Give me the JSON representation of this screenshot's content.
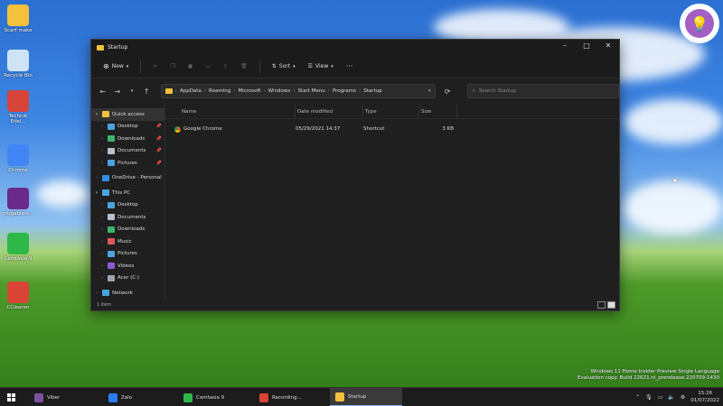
{
  "desktop": {
    "icons": [
      {
        "label": "Scarf make",
        "icon": "folder-icon",
        "color": "#f3c13a"
      },
      {
        "label": "Recycle Bin",
        "icon": "recycle-bin-icon",
        "color": "#cfe3f7"
      },
      {
        "label": "Technik Eifel...",
        "icon": "app-icon",
        "color": "#d8433a"
      },
      {
        "label": "Chrome",
        "icon": "chrome-icon",
        "color": "#4285f4"
      },
      {
        "label": "plugable-s...",
        "icon": "app-icon",
        "color": "#6a2a8a"
      },
      {
        "label": "Camtasia 9",
        "icon": "camtasia-icon",
        "color": "#2fb84a"
      },
      {
        "label": "CCleaner",
        "icon": "ccleaner-icon",
        "color": "#d94434"
      }
    ]
  },
  "window": {
    "title": "Startup",
    "controls": {
      "minimize": "–",
      "maximize": "□",
      "close": "✕"
    },
    "toolbar": {
      "new_label": "New",
      "sort_label": "Sort",
      "view_label": "View",
      "more_label": "···"
    },
    "address": {
      "crumbs": [
        "AppData",
        "Roaming",
        "Microsoft",
        "Windows",
        "Start Menu",
        "Programs",
        "Startup"
      ]
    },
    "search": {
      "placeholder": "Search Startup"
    },
    "nav": [
      {
        "label": "Quick access",
        "icon": "star-icon",
        "color": "#f3c13a",
        "level": 0,
        "expanded": true,
        "selected": true
      },
      {
        "label": "Desktop",
        "icon": "desktop-icon",
        "color": "#4aa3df",
        "level": 1,
        "pin": true
      },
      {
        "label": "Downloads",
        "icon": "download-icon",
        "color": "#3bb56b",
        "level": 1,
        "pin": true
      },
      {
        "label": "Documents",
        "icon": "documents-icon",
        "color": "#b5c2cf",
        "level": 1,
        "pin": true
      },
      {
        "label": "Pictures",
        "icon": "pictures-icon",
        "color": "#4aa3df",
        "level": 1,
        "pin": true
      },
      {
        "label": "OneDrive - Personal",
        "icon": "cloud-icon",
        "color": "#2f8fe0",
        "level": 0
      },
      {
        "label": "This PC",
        "icon": "pc-icon",
        "color": "#4aa3df",
        "level": 0,
        "expanded": true
      },
      {
        "label": "Desktop",
        "icon": "desktop-icon",
        "color": "#4aa3df",
        "level": 1
      },
      {
        "label": "Documents",
        "icon": "documents-icon",
        "color": "#b5c2cf",
        "level": 1
      },
      {
        "label": "Downloads",
        "icon": "download-icon",
        "color": "#3bb56b",
        "level": 1
      },
      {
        "label": "Music",
        "icon": "music-icon",
        "color": "#e0585a",
        "level": 1
      },
      {
        "label": "Pictures",
        "icon": "pictures-icon",
        "color": "#4aa3df",
        "level": 1
      },
      {
        "label": "Videos",
        "icon": "videos-icon",
        "color": "#8a5ad8",
        "level": 1
      },
      {
        "label": "Acer (C:)",
        "icon": "drive-icon",
        "color": "#9aa3ad",
        "level": 1
      },
      {
        "label": "Network",
        "icon": "network-icon",
        "color": "#4aa3df",
        "level": 0
      }
    ],
    "columns": [
      "Name",
      "Date modified",
      "Type",
      "Size"
    ],
    "files": [
      {
        "name": "Google Chrome",
        "date": "05/29/2021 14:37",
        "type": "Shortcut",
        "size": "3 KB"
      }
    ],
    "status": "1 item"
  },
  "watermark": {
    "line1": "Windows 11 Home Insider Preview Single Language",
    "line2": "Evaluation copy. Build 22621.ni_prerelease.220709-1430"
  },
  "taskbar": {
    "tasks": [
      {
        "label": "Viber",
        "icon": "viber-icon",
        "color": "#7b519d"
      },
      {
        "label": "Zalo",
        "icon": "zalo-icon",
        "color": "#2a7ef0"
      },
      {
        "label": "Camtasia 9",
        "icon": "camtasia-icon",
        "color": "#2fb84a"
      },
      {
        "label": "Recording...",
        "icon": "record-icon",
        "color": "#d94434"
      },
      {
        "label": "Startup",
        "icon": "folder-icon",
        "color": "#f3c13a",
        "active": true
      }
    ],
    "time": "15:26",
    "date": "01/07/2022"
  }
}
